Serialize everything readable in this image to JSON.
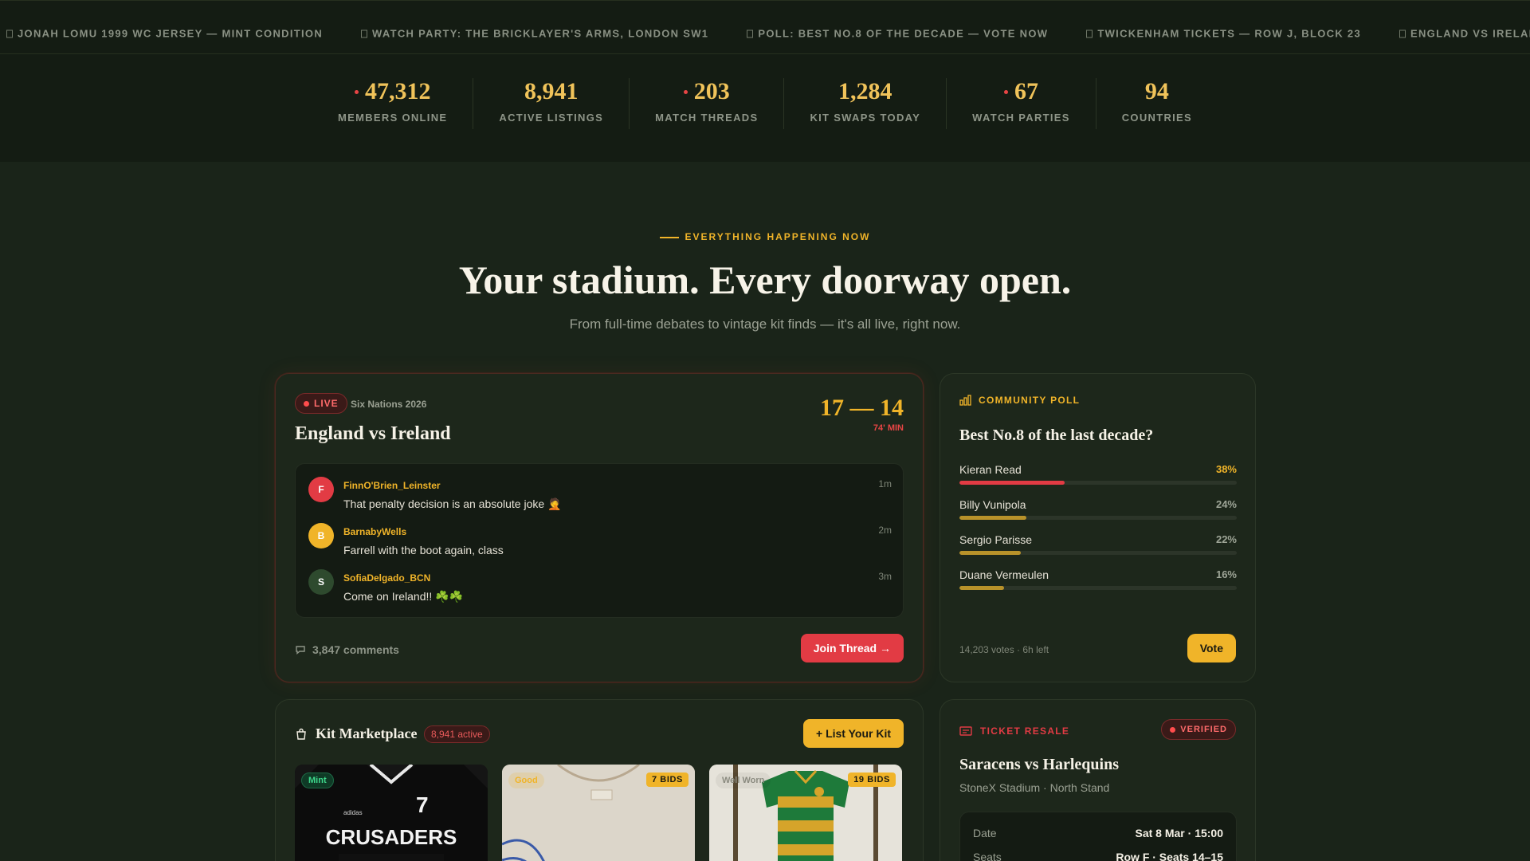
{
  "ticker": {
    "items": [
      "JONAH LOMU 1999 WC JERSEY — MINT CONDITION",
      "WATCH PARTY: THE BRICKLAYER'S ARMS, LONDON SW1",
      "POLL: BEST NO.8 OF THE DECADE — VOTE NOW",
      "TWICKENHAM TICKETS — ROW J, BLOCK 23",
      "ENGLAND VS IRELAND — MATCH THR"
    ]
  },
  "stats": [
    {
      "value": "47,312",
      "label": "MEMBERS ONLINE",
      "live": true
    },
    {
      "value": "8,941",
      "label": "ACTIVE LISTINGS",
      "live": false
    },
    {
      "value": "203",
      "label": "MATCH THREADS",
      "live": true
    },
    {
      "value": "1,284",
      "label": "KIT SWAPS TODAY",
      "live": false
    },
    {
      "value": "67",
      "label": "WATCH PARTIES",
      "live": true
    },
    {
      "value": "94",
      "label": "COUNTRIES",
      "live": false
    }
  ],
  "hero": {
    "eyebrow": "EVERYTHING HAPPENING NOW",
    "title": "Your stadium. Every doorway open.",
    "subtitle": "From full-time debates to vintage kit finds — it's all live, right now."
  },
  "live": {
    "badge": "LIVE",
    "competition": "Six Nations 2026",
    "title": "England vs Ireland",
    "score": "17 — 14",
    "minute": "74' MIN",
    "messages": [
      {
        "initial": "F",
        "user": "FinnO'Brien_Leinster",
        "text": "That penalty decision is an absolute joke 🤦",
        "time": "1m",
        "color": "#e23b44"
      },
      {
        "initial": "B",
        "user": "BarnabyWells",
        "text": "Farrell with the boot again, class",
        "time": "2m",
        "color": "#f0b429"
      },
      {
        "initial": "S",
        "user": "SofiaDelgado_BCN",
        "text": "Come on Ireland!! ☘️☘️",
        "time": "3m",
        "color": "#2e4a2e"
      }
    ],
    "comments": "3,847 comments",
    "join_label": "Join Thread →"
  },
  "poll": {
    "heading": "COMMUNITY POLL",
    "question": "Best No.8 of the last decade?",
    "options": [
      {
        "name": "Kieran Read",
        "pct": "38%",
        "value": 38,
        "color": "#e23b44"
      },
      {
        "name": "Billy Vunipola",
        "pct": "24%",
        "value": 24,
        "color": "#b8922a"
      },
      {
        "name": "Sergio Parisse",
        "pct": "22%",
        "value": 22,
        "color": "#b8922a"
      },
      {
        "name": "Duane Vermeulen",
        "pct": "16%",
        "value": 16,
        "color": "#b8922a"
      }
    ],
    "meta": "14,203 votes · 6h left",
    "vote_label": "Vote"
  },
  "market": {
    "title": "Kit Marketplace",
    "count": "8,941 active",
    "list_label": "+ List Your Kit",
    "kits": [
      {
        "condition": "Mint",
        "bids": ""
      },
      {
        "condition": "Good",
        "bids": "7 BIDS"
      },
      {
        "condition": "Well Worn",
        "bids": "19 BIDS"
      }
    ],
    "kit_text": {
      "crest": "CRUSADERS",
      "number": "7",
      "sponsor": "adidas"
    }
  },
  "ticket": {
    "heading": "TICKET RESALE",
    "badge": "VERIFIED",
    "match": "Saracens vs Harlequins",
    "venue": "StoneX Stadium · North Stand",
    "rows": [
      {
        "key": "Date",
        "value": "Sat 8 Mar · 15:00"
      },
      {
        "key": "Seats",
        "value": "Row F · Seats 14–15"
      }
    ]
  }
}
